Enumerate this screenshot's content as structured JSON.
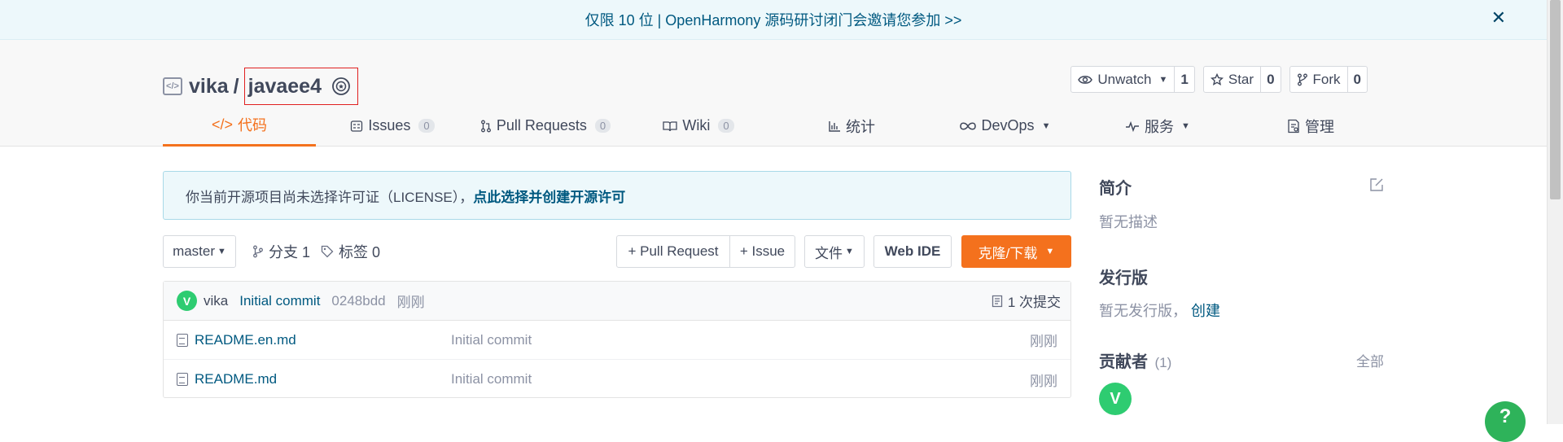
{
  "banner": {
    "text": "仅限 10 位 | OpenHarmony 源码研讨闭门会邀请您参加 >>",
    "close": "✕"
  },
  "repo": {
    "owner": "vika",
    "separator": "/",
    "name": "javaee4"
  },
  "actions": {
    "unwatch": {
      "label": "Unwatch",
      "count": "1"
    },
    "star": {
      "label": "Star",
      "count": "0"
    },
    "fork": {
      "label": "Fork",
      "count": "0"
    }
  },
  "tabs": [
    {
      "label": "代码",
      "count": ""
    },
    {
      "label": "Issues",
      "count": "0"
    },
    {
      "label": "Pull Requests",
      "count": "0"
    },
    {
      "label": "Wiki",
      "count": "0"
    },
    {
      "label": "统计",
      "count": ""
    },
    {
      "label": "DevOps",
      "count": ""
    },
    {
      "label": "服务",
      "count": ""
    },
    {
      "label": "管理",
      "count": ""
    }
  ],
  "notice": {
    "text": "你当前开源项目尚未选择许可证（LICENSE），",
    "link": "点此选择并创建开源许可"
  },
  "toolbar": {
    "branch": "master",
    "branches": "分支 1",
    "tags": "标签 0",
    "pull_request": "+ Pull Request",
    "issue": "+ Issue",
    "file": "文件",
    "web_ide": "Web IDE",
    "clone": "克隆/下载"
  },
  "commit": {
    "avatar": "V",
    "author": "vika",
    "message": "Initial commit",
    "hash": "0248bdd",
    "time": "刚刚",
    "count": "1 次提交"
  },
  "files": [
    {
      "name": "README.en.md",
      "message": "Initial commit",
      "time": "刚刚"
    },
    {
      "name": "README.md",
      "message": "Initial commit",
      "time": "刚刚"
    }
  ],
  "sidebar": {
    "intro_title": "简介",
    "intro_text": "暂无描述",
    "release_title": "发行版",
    "release_text": "暂无发行版，",
    "release_link": "创建",
    "contrib_title": "贡献者",
    "contrib_count": "(1)",
    "contrib_all": "全部",
    "contrib_avatar": "V"
  },
  "help": "?"
}
